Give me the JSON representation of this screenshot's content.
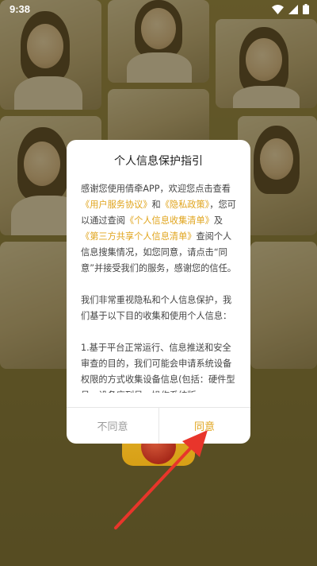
{
  "status_bar": {
    "time": "9:38",
    "icons": [
      "wifi-icon",
      "signal-icon",
      "battery-icon"
    ]
  },
  "dialog": {
    "title": "个人信息保护指引",
    "paragraph1": [
      {
        "text": "感谢您使用倩牵APP，欢迎您点击查看",
        "link": false
      },
      {
        "text": "《用户服务协议》",
        "link": true
      },
      {
        "text": "和",
        "link": false
      },
      {
        "text": "《隐私政策》",
        "link": true
      },
      {
        "text": "，您可以通过查阅",
        "link": false
      },
      {
        "text": "《个人信息收集清单》",
        "link": true
      },
      {
        "text": "及",
        "link": false
      },
      {
        "text": "《第三方共享个人信息清单》",
        "link": true
      },
      {
        "text": "查阅个人信息搜集情况，如您同意，请点击“同意”并接受我们的服务，感谢您的信任。",
        "link": false
      }
    ],
    "paragraph2": "我们非常重视隐私和个人信息保护，我们基于以下目的收集和使用个人信息：",
    "paragraph3": "1.基于平台正常运行、信息推送和安全审查的目的，我们可能会申请系统设备权限的方式收集设备信息(包括：硬件型号、设备序列号、操作系统版",
    "disagree_label": "不同意",
    "agree_label": "同意"
  },
  "colors": {
    "accent": "#e0a41c",
    "overlay": "#6e6436",
    "arrow": "#e8352b"
  }
}
